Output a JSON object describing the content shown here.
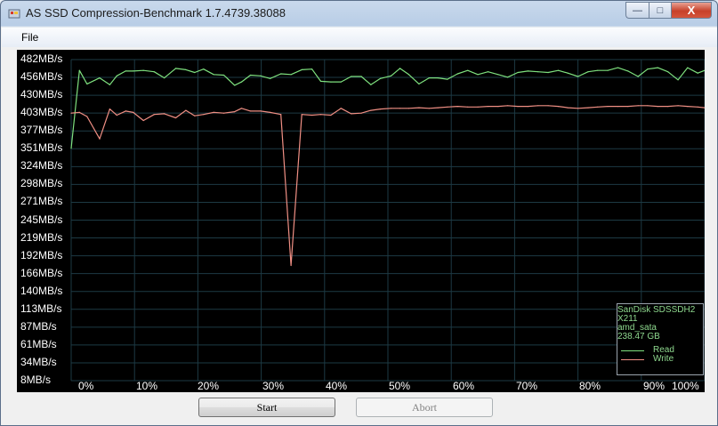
{
  "window": {
    "title": "AS SSD Compression-Benchmark 1.7.4739.38088",
    "controls": {
      "minimize": "—",
      "maximize": "□",
      "close": "X"
    }
  },
  "menu": {
    "file": "File"
  },
  "buttons": {
    "start": "Start",
    "abort": "Abort"
  },
  "legend": {
    "device_lines": [
      "SanDisk SDSSDH2",
      "X211",
      "amd_sata",
      "238.47 GB"
    ],
    "read": "Read",
    "write": "Write"
  },
  "colors": {
    "read": "#7ee07e",
    "write": "#f08f84",
    "grid": "#1d3a44",
    "legend_text": "#8ed88e"
  },
  "chart_data": {
    "type": "line",
    "title": "",
    "xlabel": "",
    "ylabel": "",
    "x_ticks": [
      "0%",
      "10%",
      "20%",
      "30%",
      "40%",
      "50%",
      "60%",
      "70%",
      "80%",
      "90%",
      "100%"
    ],
    "y_ticks": [
      "482MB/s",
      "456MB/s",
      "430MB/s",
      "403MB/s",
      "377MB/s",
      "351MB/s",
      "324MB/s",
      "298MB/s",
      "271MB/s",
      "245MB/s",
      "219MB/s",
      "192MB/s",
      "166MB/s",
      "140MB/s",
      "113MB/s",
      "87MB/s",
      "61MB/s",
      "34MB/s",
      "8MB/s"
    ],
    "xlim": [
      0,
      100
    ],
    "ylim": [
      8,
      482
    ],
    "grid": true,
    "legend_position": "bottom-right",
    "x": [
      0,
      1.3,
      2.5,
      4.5,
      6.1,
      7.2,
      8.6,
      9.8,
      11.4,
      13.1,
      14.7,
      16.5,
      18.1,
      19.5,
      20.9,
      22.5,
      24.1,
      25.8,
      26.9,
      28.3,
      29.9,
      31.4,
      33.1,
      34.7,
      36.4,
      38,
      39.4,
      41,
      42.6,
      44.2,
      45.8,
      47.3,
      48.8,
      50.5,
      51.9,
      53.3,
      54.9,
      56.5,
      57.9,
      59.4,
      61,
      62.6,
      64.2,
      65.8,
      67.4,
      68.9,
      70.5,
      72.1,
      73.7,
      75.3,
      76.9,
      78.4,
      80,
      81.6,
      83.1,
      84.7,
      86.3,
      87.9,
      89.5,
      91,
      92.6,
      94.2,
      95.8,
      97.3,
      98.9,
      100
    ],
    "series": [
      {
        "name": "Read",
        "color": "#7ee07e",
        "values": [
          351,
          466,
          446,
          455,
          445,
          458,
          465,
          465,
          466,
          464,
          455,
          469,
          467,
          463,
          468,
          460,
          459,
          444,
          449,
          459,
          458,
          454,
          461,
          460,
          467,
          468,
          450,
          449,
          449,
          457,
          457,
          445,
          454,
          458,
          469,
          460,
          446,
          455,
          455,
          453,
          461,
          466,
          460,
          464,
          460,
          456,
          463,
          465,
          464,
          463,
          466,
          462,
          457,
          464,
          466,
          466,
          470,
          465,
          457,
          468,
          470,
          464,
          452,
          470,
          462,
          466
        ]
      },
      {
        "name": "Write",
        "color": "#f08f84",
        "values": [
          403,
          404,
          398,
          365,
          409,
          400,
          406,
          404,
          392,
          401,
          402,
          396,
          407,
          399,
          401,
          404,
          403,
          405,
          410,
          406,
          406,
          404,
          401,
          178,
          401,
          400,
          401,
          400,
          410,
          402,
          403,
          407,
          409,
          410,
          410,
          410,
          411,
          410,
          411,
          412,
          413,
          412,
          412,
          413,
          413,
          414,
          413,
          413,
          414,
          414,
          413,
          411,
          410,
          411,
          412,
          413,
          413,
          413,
          414,
          414,
          413,
          413,
          414,
          413,
          412,
          411
        ]
      }
    ]
  }
}
